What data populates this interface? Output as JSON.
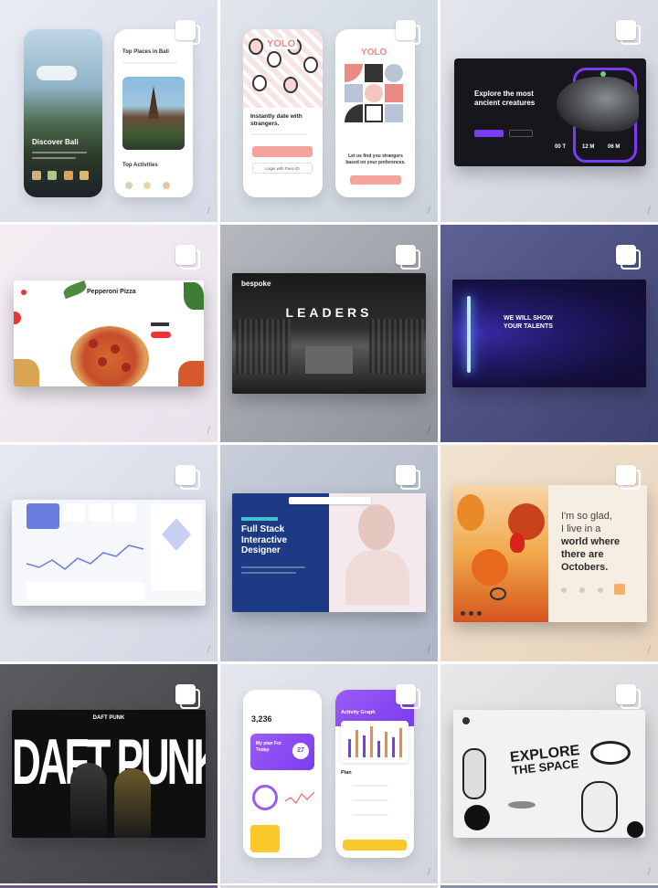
{
  "tiles": {
    "bali": {
      "top_places": "Top Places in Bali",
      "discover": "Discover Bali",
      "top_activities": "Top Activities"
    },
    "yolo": {
      "logo_left": "YOLO",
      "logo_right": "YOLO",
      "headline": "Instantly date with strangers.",
      "login_button": "Login with Face ID",
      "tagline": "Let us find you strangers based on your preferences."
    },
    "dino": {
      "headline": "Explore the most ancient creatures",
      "stats": [
        "00 T",
        "12 M",
        "06 M"
      ]
    },
    "pizza": {
      "title": "Pepperoni Pizza"
    },
    "leaders": {
      "brand": "bespoke",
      "title": "LEADERS"
    },
    "talents": {
      "headline": "WE WILL SHOW YOUR TALENTS"
    },
    "designer": {
      "headline": "Full Stack Interactive Designer"
    },
    "octobers": {
      "line1": "I'm so glad,",
      "line2": "I live in a",
      "line3": "world where",
      "line4": "there are",
      "line5": "Octobers."
    },
    "daftpunk": {
      "title": "DAFT PUNK"
    },
    "activity": {
      "steps": "3,236",
      "plan_title": "My plan For Today",
      "plan_value": "27",
      "graph_title": "Activity Graph",
      "plan_label": "Plan"
    },
    "space": {
      "line1": "EXPLORE",
      "line2": "THE SPACE"
    }
  }
}
